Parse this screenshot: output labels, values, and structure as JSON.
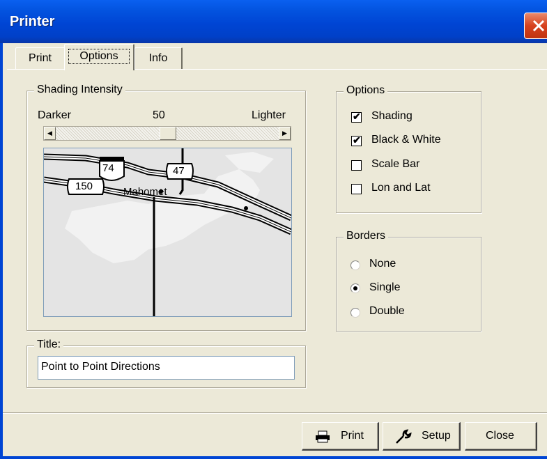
{
  "window": {
    "title": "Printer"
  },
  "tabs": [
    {
      "label": "Print",
      "active": false
    },
    {
      "label": "Options",
      "active": true
    },
    {
      "label": "Info",
      "active": false
    }
  ],
  "shading": {
    "group_label": "Shading Intensity",
    "darker_label": "Darker",
    "value": "50",
    "lighter_label": "Lighter",
    "slider_fraction": 0.5
  },
  "map": {
    "place_label": "Mahomet",
    "route_74": "74",
    "route_47": "47",
    "route_150": "150"
  },
  "title_group": {
    "label": "Title:",
    "value": "Point to Point Directions"
  },
  "options": {
    "group_label": "Options",
    "items": [
      {
        "label": "Shading",
        "checked": true
      },
      {
        "label": "Black & White",
        "checked": true
      },
      {
        "label": "Scale Bar",
        "checked": false
      },
      {
        "label": "Lon and Lat",
        "checked": false
      }
    ]
  },
  "borders": {
    "group_label": "Borders",
    "items": [
      {
        "label": "None",
        "selected": false
      },
      {
        "label": "Single",
        "selected": true
      },
      {
        "label": "Double",
        "selected": false
      }
    ]
  },
  "buttons": {
    "print": "Print",
    "setup": "Setup",
    "close": "Close"
  },
  "colors": {
    "titlebar": "#0045d4",
    "close": "#d7411e",
    "face": "#ece9d8"
  }
}
